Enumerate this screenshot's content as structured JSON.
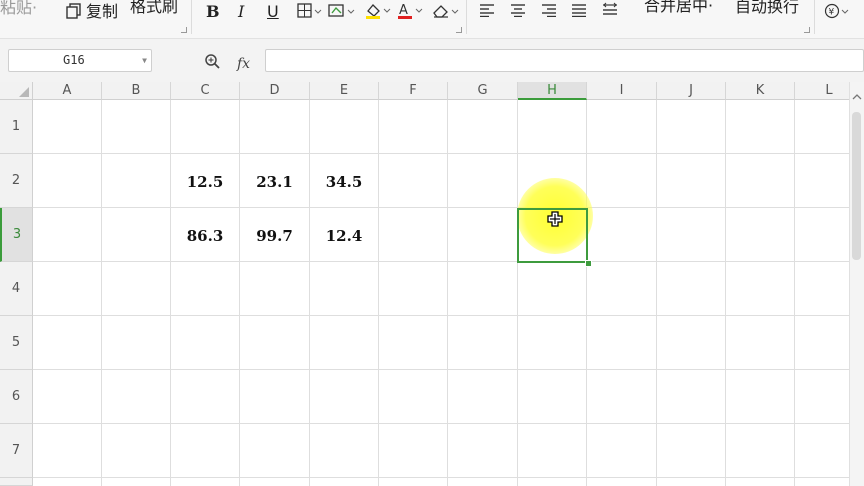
{
  "ribbon": {
    "paste": "粘贴·",
    "copy": "复制",
    "format_painter": "格式刷",
    "merge_center": "合并居中·",
    "wrap_text": "自动换行"
  },
  "formula_bar": {
    "name_box": "G16",
    "fx_label": "fx",
    "formula": ""
  },
  "columns": [
    "A",
    "B",
    "C",
    "D",
    "E",
    "F",
    "G",
    "H",
    "I",
    "J",
    "K",
    "L"
  ],
  "selected_column": "H",
  "rows": [
    "1",
    "2",
    "3",
    "4",
    "5",
    "6",
    "7"
  ],
  "selected_row": "3",
  "cells": {
    "C2": "12.5",
    "D2": "23.1",
    "E2": "34.5",
    "C3": "86.3",
    "D3": "99.7",
    "E3": "12.4"
  },
  "colors": {
    "selection": "#3e9b3e",
    "highlight": "#ffff3c"
  }
}
